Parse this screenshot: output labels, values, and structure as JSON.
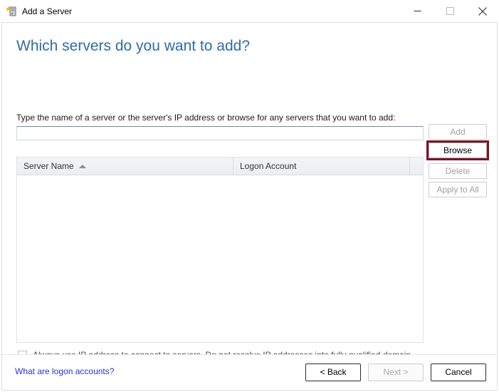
{
  "window": {
    "title": "Add a Server",
    "icon": "add-server-icon",
    "controls": {
      "minimize": "minimize-icon",
      "maximize": "maximize-icon",
      "close": "close-icon"
    }
  },
  "page": {
    "heading": "Which servers do you want to add?",
    "instruction": "Type the name of a server or the server's IP address or browse for any servers that you want to add:"
  },
  "server_input": {
    "value": "",
    "placeholder": ""
  },
  "side_buttons": [
    {
      "label": "Add",
      "enabled": false,
      "highlighted": false
    },
    {
      "label": "Browse",
      "enabled": true,
      "highlighted": true
    },
    {
      "label": "Delete",
      "enabled": false,
      "highlighted": false
    },
    {
      "label": "Apply to All",
      "enabled": false,
      "highlighted": false
    }
  ],
  "list_view": {
    "columns": [
      {
        "label": "Server Name",
        "sort": "ascending"
      },
      {
        "label": "Logon Account",
        "sort": "none"
      }
    ],
    "rows": []
  },
  "checkbox": {
    "checked": false,
    "label": "Always use IP address to connect to servers. Do not resolve IP addresses into fully qualified domain names."
  },
  "footer": {
    "help_link": "What are logon accounts?",
    "buttons": [
      {
        "label": "< Back",
        "enabled": true
      },
      {
        "label": "Next >",
        "enabled": false
      },
      {
        "label": "Cancel",
        "enabled": true
      }
    ]
  },
  "colors": {
    "heading": "#2f6ca8",
    "highlight": "#7b132b",
    "link": "#2f2fd4"
  }
}
